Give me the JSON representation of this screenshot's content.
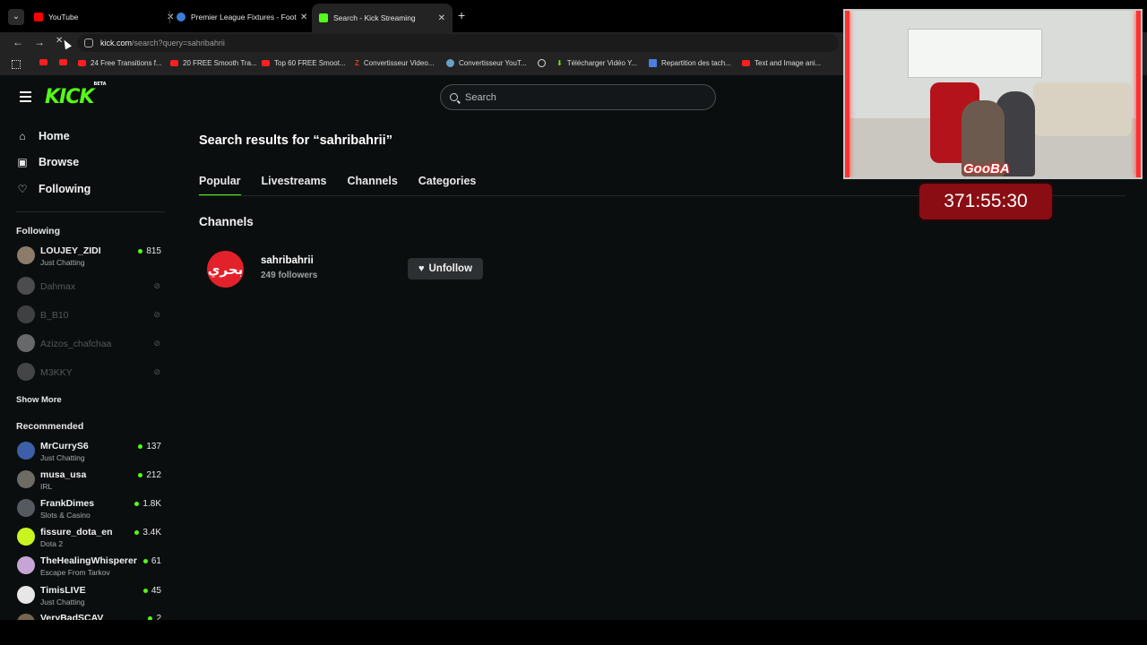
{
  "browser": {
    "tabs": [
      {
        "title": "YouTube",
        "active": false,
        "favicon_color": "#ff0000"
      },
      {
        "title": "Premier League Fixtures - Footb",
        "active": false,
        "favicon_color": "#3b7dd8"
      },
      {
        "title": "Search - Kick Streaming",
        "active": true,
        "favicon_color": "#53fc18"
      }
    ],
    "url_domain": "kick.com",
    "url_path": "/search?query=sahribahrii",
    "bookmarks": [
      {
        "label": "",
        "icon": "youtube-icon"
      },
      {
        "label": "",
        "icon": "youtube-icon"
      },
      {
        "label": "24 Free Transitions f...",
        "icon": "youtube-icon"
      },
      {
        "label": "20 FREE Smooth Tra...",
        "icon": "youtube-icon"
      },
      {
        "label": "Top 60 FREE Smoot...",
        "icon": "youtube-icon"
      },
      {
        "label": "Convertisseur Video...",
        "icon": "z-icon"
      },
      {
        "label": "Convertisseur YouT...",
        "icon": "converter-icon"
      },
      {
        "label": "",
        "icon": "globe-icon"
      },
      {
        "label": "Télécharger Vidéo Y...",
        "icon": "download-icon"
      },
      {
        "label": "Repartition des tach...",
        "icon": "doc-icon"
      },
      {
        "label": "Text and Image ani...",
        "icon": "youtube-icon"
      }
    ]
  },
  "site": {
    "logo": "KICK",
    "logo_badge": "BETA",
    "search_placeholder": "Search",
    "accent": "#53fc18"
  },
  "sidebar": {
    "nav": [
      {
        "label": "Home",
        "icon": "home-icon"
      },
      {
        "label": "Browse",
        "icon": "browse-icon"
      },
      {
        "label": "Following",
        "icon": "heart-icon"
      }
    ],
    "following_heading": "Following",
    "following": [
      {
        "name": "LOUJEY_ZIDI",
        "category": "Just Chatting",
        "viewers": "815",
        "live": true
      },
      {
        "name": "Dahmax",
        "live": false
      },
      {
        "name": "B_B10",
        "live": false
      },
      {
        "name": "Azizos_chafchaa",
        "live": false
      },
      {
        "name": "M3KKY",
        "live": false
      }
    ],
    "show_more": "Show More",
    "recommended_heading": "Recommended",
    "recommended": [
      {
        "name": "MrCurryS6",
        "category": "Just Chatting",
        "viewers": "137"
      },
      {
        "name": "musa_usa",
        "category": "IRL",
        "viewers": "212"
      },
      {
        "name": "FrankDimes",
        "category": "Slots & Casino",
        "viewers": "1.8K"
      },
      {
        "name": "fissure_dota_en",
        "category": "Dota 2",
        "viewers": "3.4K"
      },
      {
        "name": "TheHealingWhisperer",
        "category": "Escape From Tarkov",
        "viewers": "61"
      },
      {
        "name": "TimisLIVE",
        "category": "Just Chatting",
        "viewers": "45"
      },
      {
        "name": "VeryBadSCAV",
        "category": "",
        "viewers": "2"
      }
    ]
  },
  "main": {
    "title": "Search results for “sahribahrii”",
    "tabs": [
      "Popular",
      "Livestreams",
      "Channels",
      "Categories"
    ],
    "section": "Channels",
    "result": {
      "name": "sahribahrii",
      "followers": "249 followers",
      "avatar_text": "بحري",
      "button": "Unfollow"
    }
  },
  "overlay": {
    "tag": "GooBA",
    "timer": "371:55:30"
  }
}
